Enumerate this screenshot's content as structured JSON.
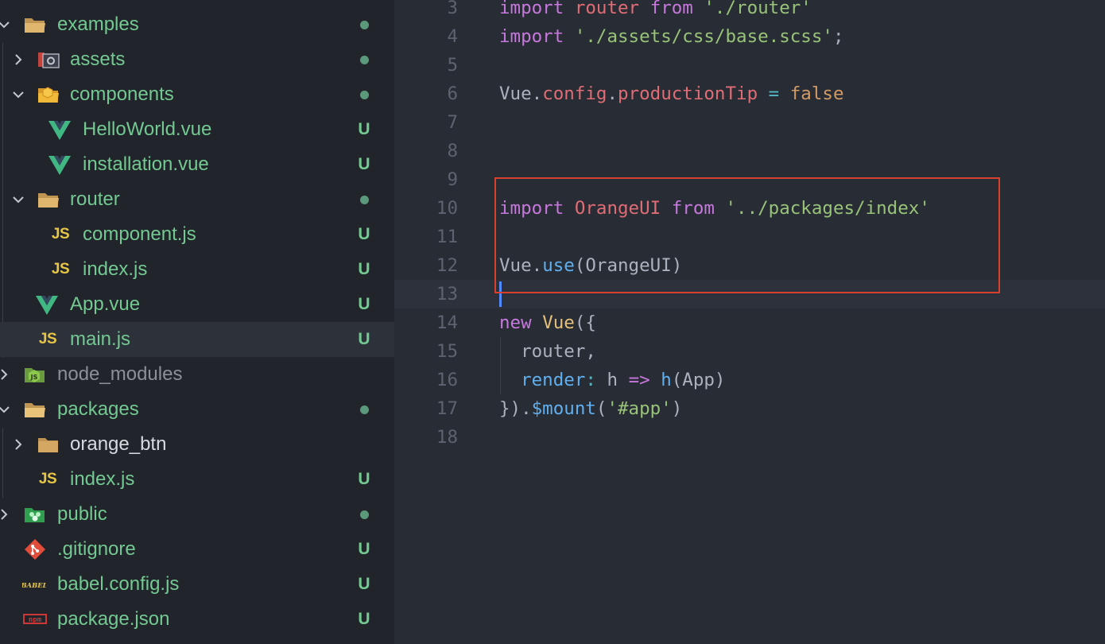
{
  "explorer": {
    "rows": [
      {
        "label": "examples",
        "color": "#73c991",
        "expanded": true,
        "decoration": "dot"
      },
      {
        "label": "assets",
        "color": "#73c991",
        "expanded": false,
        "decoration": "dot"
      },
      {
        "label": "components",
        "color": "#73c991",
        "expanded": true,
        "decoration": "dot"
      },
      {
        "label": "HelloWorld.vue",
        "color": "#73c991",
        "decoration": "U"
      },
      {
        "label": "installation.vue",
        "color": "#73c991",
        "decoration": "U"
      },
      {
        "label": "router",
        "color": "#73c991",
        "expanded": true,
        "decoration": "dot"
      },
      {
        "label": "component.js",
        "color": "#73c991",
        "decoration": "U"
      },
      {
        "label": "index.js",
        "color": "#73c991",
        "decoration": "U"
      },
      {
        "label": "App.vue",
        "color": "#73c991",
        "decoration": "U"
      },
      {
        "label": "main.js",
        "color": "#73c991",
        "decoration": "U",
        "selected": true
      },
      {
        "label": "node_modules",
        "color": "#8b9098",
        "expanded": false
      },
      {
        "label": "packages",
        "color": "#73c991",
        "expanded": true,
        "decoration": "dot"
      },
      {
        "label": "orange_btn",
        "color": "#d7dae0",
        "expanded": false
      },
      {
        "label": "index.js",
        "color": "#73c991",
        "decoration": "U"
      },
      {
        "label": "public",
        "color": "#73c991",
        "expanded": false,
        "decoration": "dot"
      },
      {
        "label": ".gitignore",
        "color": "#73c991",
        "decoration": "U"
      },
      {
        "label": "babel.config.js",
        "color": "#73c991",
        "decoration": "U"
      },
      {
        "label": "package.json",
        "color": "#73c991",
        "decoration": "U"
      }
    ],
    "icon_labels": {
      "js": "JS",
      "babel": "BABEL",
      "npm": "npm",
      "node_js": "JS"
    }
  },
  "editor": {
    "line_numbers": [
      "3",
      "4",
      "5",
      "6",
      "7",
      "8",
      "9",
      "10",
      "11",
      "12",
      "13",
      "14",
      "15",
      "16",
      "17",
      "18"
    ],
    "current_line": "13",
    "lines": [
      [
        [
          "kw",
          "import "
        ],
        [
          "var",
          "router "
        ],
        [
          "kw",
          "from "
        ],
        [
          "str",
          "'./router'"
        ]
      ],
      [
        [
          "kw",
          "import "
        ],
        [
          "str",
          "'./assets/css/base.scss'"
        ],
        [
          "punc",
          ";"
        ]
      ],
      [],
      [
        [
          "punc",
          "Vue."
        ],
        [
          "prop",
          "config"
        ],
        [
          "punc",
          "."
        ],
        [
          "prop",
          "productionTip "
        ],
        [
          "op",
          "= "
        ],
        [
          "bool",
          "false"
        ]
      ],
      [],
      [],
      [],
      [
        [
          "kw",
          "import "
        ],
        [
          "var",
          "OrangeUI "
        ],
        [
          "kw",
          "from "
        ],
        [
          "str",
          "'../packages/index'"
        ]
      ],
      [],
      [
        [
          "punc",
          "Vue."
        ],
        [
          "fn",
          "use"
        ],
        [
          "punc",
          "(OrangeUI)"
        ]
      ],
      [],
      [
        [
          "kw",
          "new "
        ],
        [
          "cls",
          "Vue"
        ],
        [
          "punc",
          "({"
        ]
      ],
      [
        [
          "punc",
          "  router,"
        ]
      ],
      [
        [
          "punc",
          "  "
        ],
        [
          "fn",
          "render"
        ],
        [
          "op",
          ": "
        ],
        [
          "punc",
          "h "
        ],
        [
          "kw",
          "=> "
        ],
        [
          "fn",
          "h"
        ],
        [
          "punc",
          "(App)"
        ]
      ],
      [
        [
          "punc",
          "})."
        ],
        [
          "fn",
          "$mount"
        ],
        [
          "punc",
          "("
        ],
        [
          "str",
          "'#app'"
        ],
        [
          "punc",
          ")"
        ]
      ],
      []
    ],
    "colors": {
      "keyword": "#c678dd",
      "string": "#98c379",
      "function": "#61afef",
      "annotation_box": "#d9402b"
    }
  }
}
